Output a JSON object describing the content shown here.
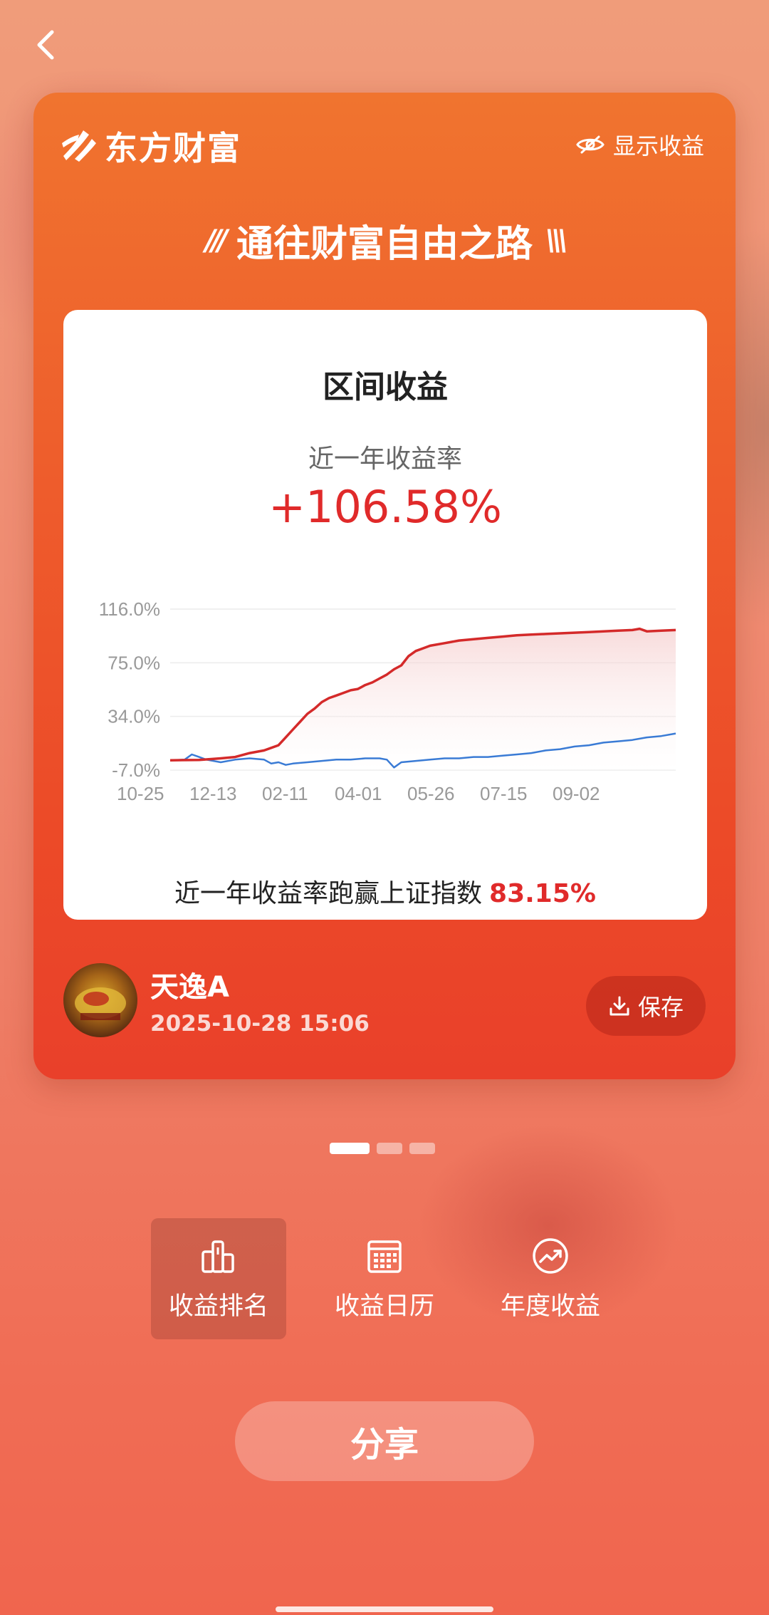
{
  "header": {
    "back_icon": "chevron-left-icon"
  },
  "card": {
    "brand": "东方财富",
    "show_profit_label": "显示收益",
    "slogan": "通往财富自由之路",
    "slogan_left_deco": "///",
    "slogan_right_deco": "\\\\\\",
    "panel": {
      "title": "区间收益",
      "rate_label": "近一年收益率",
      "rate_value": "+106.58%",
      "beat_text": "近一年收益率跑赢上证指数",
      "beat_value": "83.15%"
    },
    "user": {
      "name": "天逸A",
      "time": "2025-10-28 15:06"
    },
    "save_label": "保存"
  },
  "pager": {
    "total": 3,
    "active": 0
  },
  "actions": [
    {
      "label": "收益排名",
      "icon": "ranking-icon",
      "active": true
    },
    {
      "label": "收益日历",
      "icon": "calendar-icon",
      "active": false
    },
    {
      "label": "年度收益",
      "icon": "trend-icon",
      "active": false
    }
  ],
  "share_label": "分享",
  "colors": {
    "accent_red": "#e02a2a",
    "benchmark_blue": "#3a7bd5"
  },
  "chart_data": {
    "type": "line",
    "y_ticks": [
      "116.0%",
      "75.0%",
      "34.0%",
      "-7.0%"
    ],
    "ylim": [
      -7.0,
      116.0
    ],
    "x_ticks": [
      "10-25",
      "12-13",
      "02-11",
      "04-01",
      "05-26",
      "07-15",
      "09-02"
    ],
    "grid": true,
    "series": [
      {
        "color": "#d42a2a",
        "fill": true,
        "points": [
          [
            0,
            0.5
          ],
          [
            4,
            0.8
          ],
          [
            7,
            2
          ],
          [
            9,
            3
          ],
          [
            11,
            6
          ],
          [
            13,
            8
          ],
          [
            15,
            12
          ],
          [
            16,
            18
          ],
          [
            17,
            24
          ],
          [
            18,
            30
          ],
          [
            19,
            36
          ],
          [
            20,
            40
          ],
          [
            21,
            45
          ],
          [
            22,
            48
          ],
          [
            23,
            50
          ],
          [
            24,
            52
          ],
          [
            25,
            54
          ],
          [
            26,
            55
          ],
          [
            27,
            58
          ],
          [
            28,
            60
          ],
          [
            29,
            63
          ],
          [
            30,
            66
          ],
          [
            31,
            70
          ],
          [
            32,
            73
          ],
          [
            33,
            80
          ],
          [
            34,
            84
          ],
          [
            35,
            86
          ],
          [
            36,
            88
          ],
          [
            38,
            90
          ],
          [
            40,
            92
          ],
          [
            42,
            93
          ],
          [
            44,
            94
          ],
          [
            46,
            95
          ],
          [
            48,
            96
          ],
          [
            50,
            96.5
          ],
          [
            52,
            97
          ],
          [
            54,
            97.5
          ],
          [
            56,
            98
          ],
          [
            58,
            98.5
          ],
          [
            60,
            99
          ],
          [
            62,
            99.5
          ],
          [
            64,
            100
          ],
          [
            65,
            101
          ],
          [
            66,
            99
          ],
          [
            68,
            99.5
          ],
          [
            70,
            100
          ]
        ]
      },
      {
        "color": "#3a7bd5",
        "fill": false,
        "points": [
          [
            0,
            0.5
          ],
          [
            2,
            1
          ],
          [
            3,
            5
          ],
          [
            4,
            3
          ],
          [
            5,
            1
          ],
          [
            7,
            -1
          ],
          [
            9,
            1
          ],
          [
            11,
            2
          ],
          [
            13,
            1
          ],
          [
            14,
            -2
          ],
          [
            15,
            -1
          ],
          [
            16,
            -3
          ],
          [
            17,
            -2
          ],
          [
            19,
            -1
          ],
          [
            21,
            0
          ],
          [
            23,
            1
          ],
          [
            25,
            1
          ],
          [
            27,
            2
          ],
          [
            29,
            2
          ],
          [
            30,
            1
          ],
          [
            31,
            -5
          ],
          [
            32,
            -1
          ],
          [
            34,
            0
          ],
          [
            36,
            1
          ],
          [
            38,
            2
          ],
          [
            40,
            2
          ],
          [
            42,
            3
          ],
          [
            44,
            3
          ],
          [
            46,
            4
          ],
          [
            48,
            5
          ],
          [
            50,
            6
          ],
          [
            52,
            8
          ],
          [
            54,
            9
          ],
          [
            56,
            11
          ],
          [
            58,
            12
          ],
          [
            60,
            14
          ],
          [
            62,
            15
          ],
          [
            64,
            16
          ],
          [
            66,
            18
          ],
          [
            68,
            19
          ],
          [
            70,
            21
          ]
        ]
      }
    ]
  }
}
